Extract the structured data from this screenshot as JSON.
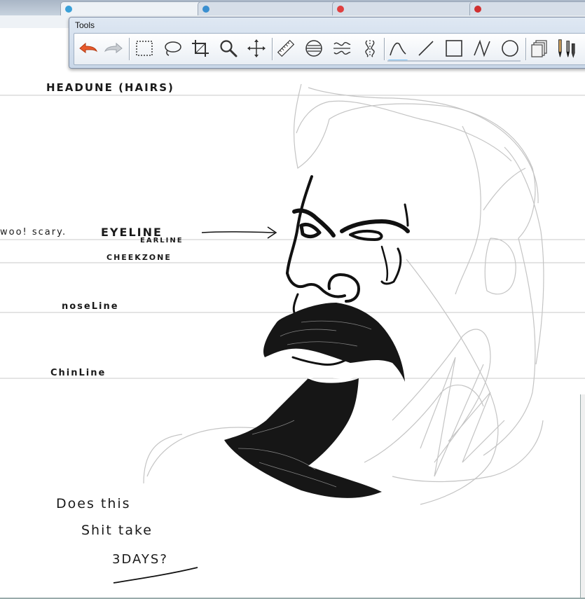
{
  "browser": {
    "tabs": [
      {
        "label": "",
        "favicon_color": "#3aa0d8",
        "active": true
      },
      {
        "label": "",
        "favicon_color": "#3a8fd0",
        "active": false
      },
      {
        "label": "",
        "favicon_color": "#e04040",
        "active": false
      },
      {
        "label": "",
        "favicon_color": "#d03030",
        "active": false
      }
    ]
  },
  "tools_window": {
    "title": "Tools",
    "tools": [
      {
        "name": "undo",
        "icon": "undo-arrow-icon"
      },
      {
        "name": "redo",
        "icon": "redo-arrow-icon"
      },
      {
        "name": "rectangle-select",
        "icon": "rectangle-select-icon"
      },
      {
        "name": "lasso-select",
        "icon": "lasso-icon"
      },
      {
        "name": "crop",
        "icon": "crop-icon"
      },
      {
        "name": "zoom",
        "icon": "magnifier-icon"
      },
      {
        "name": "move",
        "icon": "move-icon"
      },
      {
        "name": "ruler",
        "icon": "ruler-icon"
      },
      {
        "name": "symmetry-horizontal",
        "icon": "symmetry-circle-icon"
      },
      {
        "name": "symmetry-wave",
        "icon": "wave-symmetry-icon"
      },
      {
        "name": "symmetry-vertical",
        "icon": "vertical-symmetry-icon"
      },
      {
        "name": "freehand-line",
        "icon": "curve-icon",
        "selected": true
      },
      {
        "name": "straight-line",
        "icon": "line-icon"
      },
      {
        "name": "rectangle",
        "icon": "rectangle-icon"
      },
      {
        "name": "polyline",
        "icon": "polyline-icon"
      },
      {
        "name": "ellipse",
        "icon": "ellipse-icon"
      },
      {
        "name": "layers",
        "icon": "layers-icon"
      },
      {
        "name": "brushes",
        "icon": "pencil-brush-icon"
      }
    ]
  },
  "sketch": {
    "notes": {
      "headline": "HEADUNE (HAIRS)",
      "wow": "woo! scary.",
      "eyeline": "EYELINE",
      "earline": "EARLINE",
      "cheekzone": "CHEEKZONE",
      "noseline": "noseLine",
      "chinline": "ChinLine",
      "question_1": "Does this",
      "question_2": "Shit take",
      "question_3": "3DAYS?"
    },
    "ink_color": "#111111",
    "guide_color": "#c8c8c8"
  }
}
